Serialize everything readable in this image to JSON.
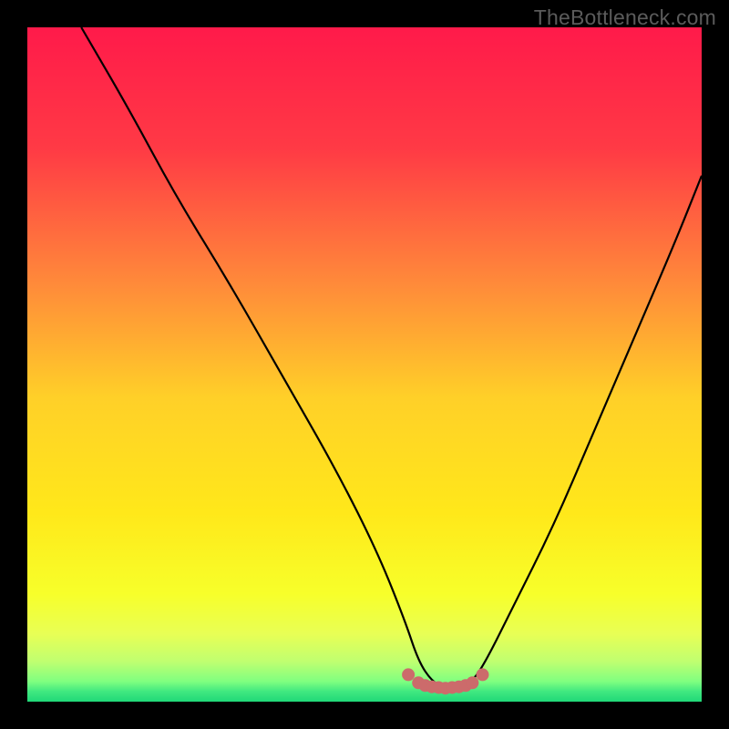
{
  "watermark": "TheBottleneck.com",
  "chart_data": {
    "type": "line",
    "title": "",
    "xlabel": "",
    "ylabel": "",
    "xlim": [
      0,
      100
    ],
    "ylim": [
      0,
      100
    ],
    "grid": false,
    "gradient_stops": [
      {
        "offset": 0.0,
        "color": "#ff1a4a"
      },
      {
        "offset": 0.18,
        "color": "#ff3a45"
      },
      {
        "offset": 0.38,
        "color": "#ff8a3a"
      },
      {
        "offset": 0.55,
        "color": "#ffd028"
      },
      {
        "offset": 0.72,
        "color": "#ffe81a"
      },
      {
        "offset": 0.84,
        "color": "#f7ff2a"
      },
      {
        "offset": 0.9,
        "color": "#e8ff55"
      },
      {
        "offset": 0.94,
        "color": "#c0ff70"
      },
      {
        "offset": 0.97,
        "color": "#80ff80"
      },
      {
        "offset": 0.985,
        "color": "#40e880"
      },
      {
        "offset": 1.0,
        "color": "#20d878"
      }
    ],
    "series": [
      {
        "name": "bottleneck-curve",
        "color": "#000000",
        "x": [
          8,
          15,
          22,
          30,
          38,
          46,
          52,
          56,
          58,
          60,
          62,
          64,
          66,
          68,
          72,
          78,
          84,
          90,
          96,
          100
        ],
        "y": [
          100,
          88,
          75,
          62,
          48,
          34,
          22,
          12,
          6,
          3,
          2,
          2,
          3,
          6,
          14,
          26,
          40,
          54,
          68,
          78
        ]
      },
      {
        "name": "highlight-dots",
        "color": "#cc6b6b",
        "type": "scatter",
        "x": [
          56.5,
          58,
          59,
          60,
          61,
          62,
          63,
          64,
          65,
          66,
          67.5
        ],
        "y": [
          4.0,
          2.8,
          2.4,
          2.2,
          2.1,
          2.0,
          2.1,
          2.2,
          2.4,
          2.8,
          4.0
        ]
      }
    ]
  }
}
